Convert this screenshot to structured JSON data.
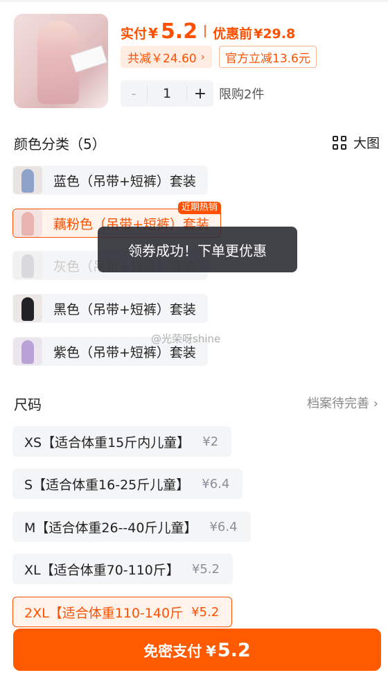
{
  "product": {
    "pay_label": "实付",
    "currency": "¥",
    "pay_price": "5.2",
    "orig_label": "优惠前",
    "orig_price": "¥29.8",
    "discount_chip": "共减￥24.60",
    "official_chip": "官方立减13.6元",
    "quantity": "1",
    "minus": "-",
    "plus": "+",
    "limit_text": "限购2件"
  },
  "colors": {
    "title": "颜色分类（5）",
    "big_view_label": "大图",
    "items": [
      {
        "label": "蓝色（吊带+短裤）套装"
      },
      {
        "label": "藕粉色（吊带+短裤）套装",
        "tag": "近期热销"
      },
      {
        "label": "灰色（吊带+短裤）套装"
      },
      {
        "label": "黑色（吊带+短裤）套装"
      },
      {
        "label": "紫色（吊带+短裤）套装"
      }
    ],
    "swatch_colors": [
      "#8da3c9",
      "#e9b3b0",
      "#b9b9bf",
      "#222226",
      "#b9a3d6"
    ]
  },
  "toast": "领券成功！下单更优惠",
  "watermark": "@光荣呀shine",
  "sizes": {
    "title": "尺码",
    "hint": "档案待完善",
    "items": [
      {
        "label": "XS【适合体重15斤内儿童】",
        "price": "¥2"
      },
      {
        "label": "S【适合体重16-25斤儿童】",
        "price": "¥6.4"
      },
      {
        "label": "M【适合体重26--40斤儿童】",
        "price": "¥6.4"
      },
      {
        "label": "XL【适合体重70-110斤】",
        "price": "¥5.2"
      },
      {
        "label": "2XL【适合体重110-140斤",
        "price": "¥5.2"
      }
    ]
  },
  "pay_button": {
    "label": "免密支付",
    "currency": "¥",
    "amount": "5.2"
  },
  "theme": {
    "accent": "#ff5000"
  }
}
